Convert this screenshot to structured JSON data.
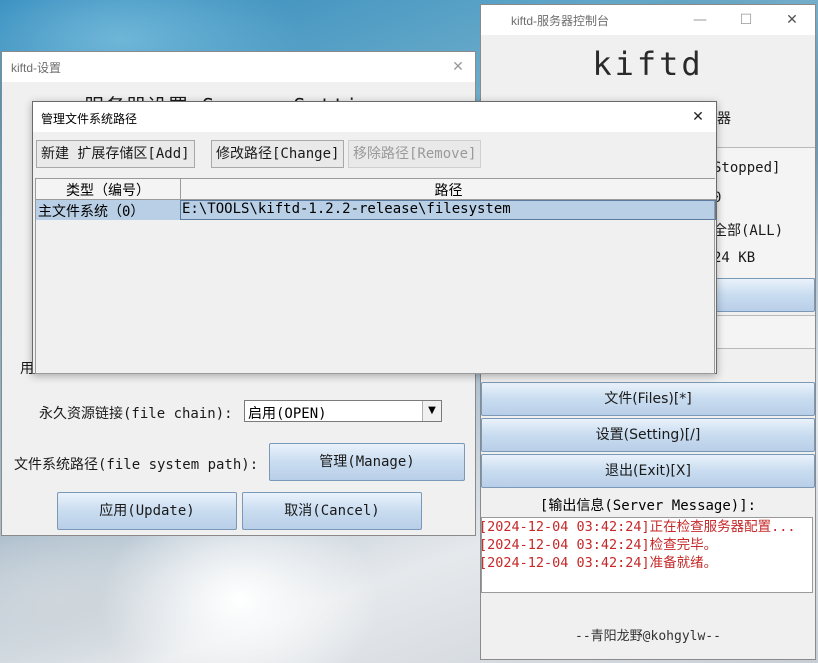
{
  "console_window": {
    "title": "kiftd-服务器控制台",
    "brand": "kiftd",
    "partial_label": "器",
    "status_lines": [
      "Stopped]",
      "0",
      "全部(ALL)",
      "24 KB"
    ],
    "buttons": {
      "files": "文件(Files)[*]",
      "setting": "设置(Setting)[/]",
      "exit": "退出(Exit)[X]"
    },
    "message_title": "[输出信息(Server Message)]:",
    "log": [
      "[2024-12-04 03:42:24]正在检查服务器配置...",
      "[2024-12-04 03:42:24]检查完毕。",
      "[2024-12-04 03:42:24]准备就绪。"
    ],
    "footer": "--青阳龙野@kohgylw--",
    "log_color": "#c62828"
  },
  "settings_window": {
    "title": "kiftd-设置",
    "heading": "服务器设置 Server Setting",
    "partial_label": "用",
    "file_chain_label": "永久资源链接(file chain):",
    "file_chain_value": "启用(OPEN)",
    "fs_path_label": "文件系统路径(file system path):",
    "manage_button": "管理(Manage)",
    "update_button": "应用(Update)",
    "cancel_button": "取消(Cancel)"
  },
  "manage_dialog": {
    "title": "管理文件系统路径",
    "add_button": "新建 扩展存储区[Add]",
    "change_button": "修改路径[Change]",
    "remove_button": "移除路径[Remove]",
    "columns": [
      "类型（编号）",
      "路径"
    ],
    "rows": [
      {
        "type": "主文件系统（0）",
        "path": "E:\\TOOLS\\kiftd-1.2.2-release\\filesystem"
      }
    ],
    "selection_color": "#b8cfe5"
  },
  "icons": [
    "close-icon",
    "minimize-icon",
    "maximize-icon",
    "chevron-down-icon"
  ]
}
